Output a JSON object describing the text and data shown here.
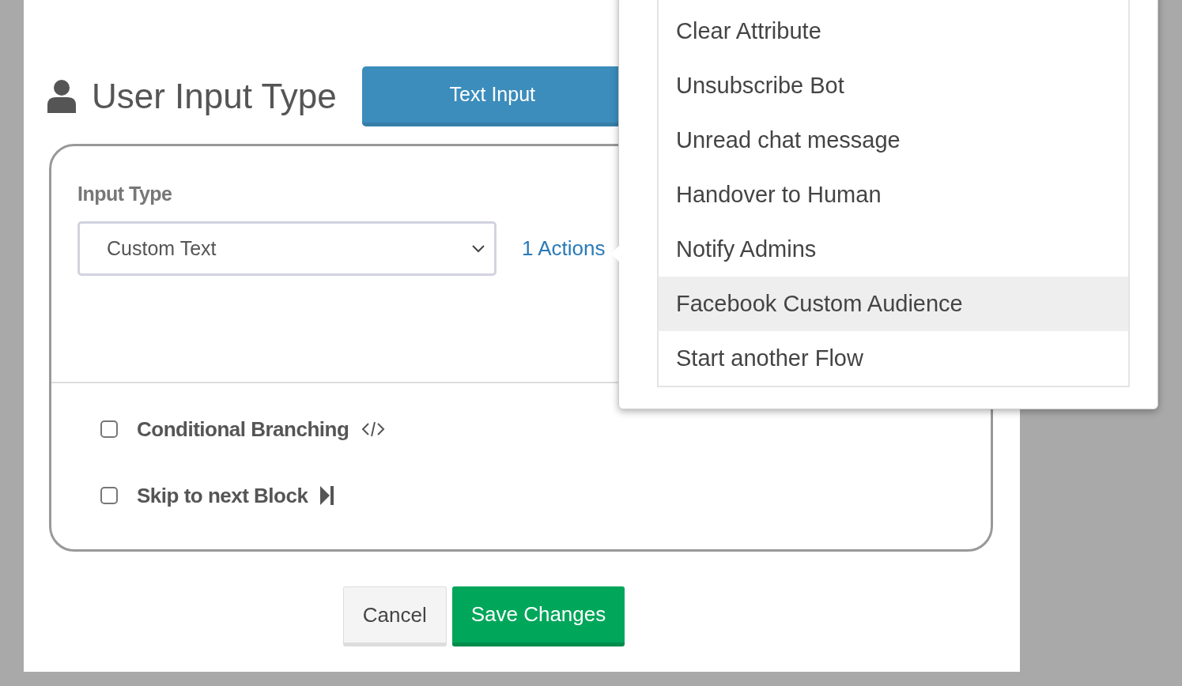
{
  "header": {
    "title": "User Input Type",
    "type_button": "Text Input"
  },
  "input_type": {
    "label": "Input Type",
    "value": "Custom Text",
    "actions_link": "1 Actions"
  },
  "options": [
    {
      "label": "Conditional Branching",
      "checked": false,
      "kind": "code"
    },
    {
      "label": "Skip to next Block",
      "checked": false,
      "kind": "skip"
    }
  ],
  "buttons": [
    {
      "label": "Cancel",
      "kind": "secondary"
    },
    {
      "label": "Save Changes",
      "kind": "primary"
    }
  ],
  "action_menu": {
    "items": [
      {
        "label": "Clear Attribute",
        "selected": false
      },
      {
        "label": "Unsubscribe Bot",
        "selected": false
      },
      {
        "label": "Unread chat message",
        "selected": false
      },
      {
        "label": "Handover to Human",
        "selected": false
      },
      {
        "label": "Notify Admins",
        "selected": false
      },
      {
        "label": "Facebook Custom Audience",
        "selected": true
      },
      {
        "label": "Start another Flow",
        "selected": false
      }
    ]
  }
}
